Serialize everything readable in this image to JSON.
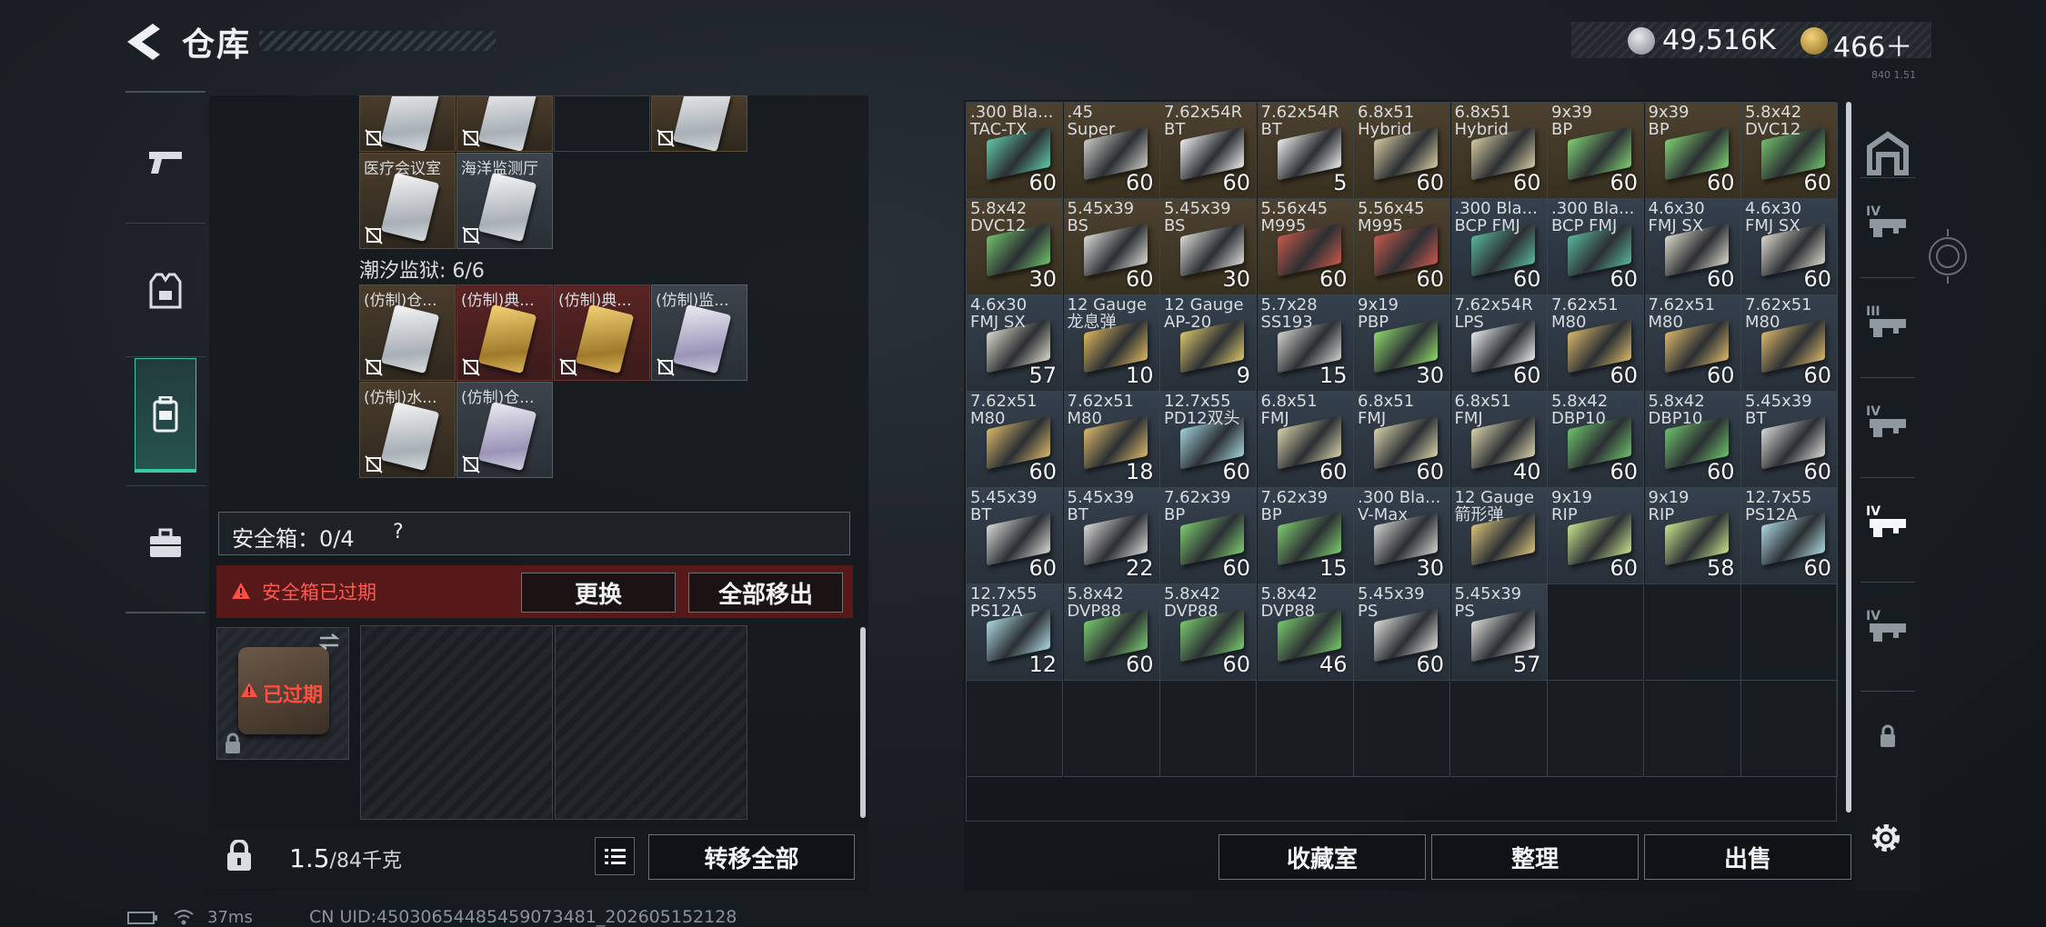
{
  "header": {
    "title": "仓库",
    "currency": [
      {
        "icon": "silver-coin-icon",
        "value": "49,516K"
      },
      {
        "icon": "gold-coin-icon",
        "value": "466＋"
      }
    ],
    "version_tiny": "840 1.51"
  },
  "left_nav": {
    "items": [
      {
        "name": "weapons",
        "icon": "pistol-icon",
        "active": false
      },
      {
        "name": "equipment",
        "icon": "vest-icon",
        "active": false
      },
      {
        "name": "storage",
        "icon": "backpack-icon",
        "active": true
      },
      {
        "name": "cases",
        "icon": "briefcase-icon",
        "active": false
      }
    ]
  },
  "keycards": {
    "top_row": [
      {
        "label": "",
        "style": "brown",
        "card": "white"
      },
      {
        "label": "",
        "style": "brown",
        "card": "white"
      },
      {
        "label": "",
        "style": "empty",
        "card": ""
      },
      {
        "label": "",
        "style": "brown",
        "card": "white"
      }
    ],
    "row2": [
      {
        "label": "医疗会议室",
        "style": "brown",
        "card": "white"
      },
      {
        "label": "海洋监测厅",
        "style": "gray",
        "card": "white"
      }
    ],
    "prison_label": "潮汐监狱: 6/6",
    "prison_row1": [
      {
        "label": "(仿制)仓...",
        "style": "brown",
        "card": "white"
      },
      {
        "label": "(仿制)典...",
        "style": "red",
        "card": "gold"
      },
      {
        "label": "(仿制)典...",
        "style": "red",
        "card": "gold"
      },
      {
        "label": "(仿制)监...",
        "style": "gray",
        "card": "purple"
      }
    ],
    "prison_row2": [
      {
        "label": "(仿制)水...",
        "style": "brown",
        "card": "white"
      },
      {
        "label": "(仿制)仓...",
        "style": "gray",
        "card": "purple"
      }
    ]
  },
  "safe_box": {
    "label": "安全箱：0/4",
    "help": "?",
    "expired_text": "安全箱已过期",
    "replace_label": "更换",
    "move_all_label": "全部移出",
    "case_expired_label": "已过期"
  },
  "weight": {
    "current": "1.5",
    "max": "/84千克",
    "transfer_label": "转移全部"
  },
  "ammo_grid": [
    {
      "name": ".300 Bla...\nTAC-TX",
      "count": "60",
      "color": "#5fc6a8",
      "tone": "b"
    },
    {
      "name": ".45\nSuper",
      "count": "60",
      "color": "#c9c9c4",
      "tone": "b"
    },
    {
      "name": "7.62x54R\nBT",
      "count": "60",
      "color": "#e9eaeb",
      "tone": "b"
    },
    {
      "name": "7.62x54R\nBT",
      "count": "5",
      "color": "#e9eaeb",
      "tone": "b"
    },
    {
      "name": "6.8x51\nHybrid",
      "count": "60",
      "color": "#d2c8a0",
      "tone": "b"
    },
    {
      "name": "6.8x51\nHybrid",
      "count": "60",
      "color": "#d2c8a0",
      "tone": "b"
    },
    {
      "name": "9x39\nBP",
      "count": "60",
      "color": "#7fcf72",
      "tone": "b"
    },
    {
      "name": "9x39\nBP",
      "count": "60",
      "color": "#7fcf72",
      "tone": "b"
    },
    {
      "name": "5.8x42\nDVC12",
      "count": "60",
      "color": "#6fbf6a",
      "tone": "b"
    },
    {
      "name": "5.8x42\nDVC12",
      "count": "30",
      "color": "#6fbf6a",
      "tone": "b"
    },
    {
      "name": "5.45x39\nBS",
      "count": "60",
      "color": "#d8d8d4",
      "tone": "b"
    },
    {
      "name": "5.45x39\nBS",
      "count": "30",
      "color": "#d8d8d4",
      "tone": "b"
    },
    {
      "name": "5.56x45\nM995",
      "count": "60",
      "color": "#c4584a",
      "tone": "b"
    },
    {
      "name": "5.56x45\nM995",
      "count": "60",
      "color": "#c4584a",
      "tone": "b"
    },
    {
      "name": ".300 Bla...\nBCP FMJ",
      "count": "60",
      "color": "#58b59a",
      "tone": "g"
    },
    {
      "name": ".300 Bla...\nBCP FMJ",
      "count": "60",
      "color": "#58b59a",
      "tone": "g"
    },
    {
      "name": "4.6x30\nFMJ SX",
      "count": "60",
      "color": "#d9d5c8",
      "tone": "g"
    },
    {
      "name": "4.6x30\nFMJ SX",
      "count": "60",
      "color": "#d9d5c8",
      "tone": "g"
    },
    {
      "name": "4.6x30\nFMJ SX",
      "count": "57",
      "color": "#d9d5c8",
      "tone": "g"
    },
    {
      "name": "12 Gauge\n龙息弹",
      "count": "10",
      "color": "#d9b55c",
      "tone": "g"
    },
    {
      "name": "12 Gauge\nAP-20",
      "count": "9",
      "color": "#d9c36a",
      "tone": "g"
    },
    {
      "name": "5.7x28\nSS193",
      "count": "15",
      "color": "#cfcfca",
      "tone": "g"
    },
    {
      "name": "9x19\nPBP",
      "count": "30",
      "color": "#8fd86a",
      "tone": "g"
    },
    {
      "name": "7.62x54R\nLPS",
      "count": "60",
      "color": "#e6e7e8",
      "tone": "g"
    },
    {
      "name": "7.62x51\nM80",
      "count": "60",
      "color": "#d8b66a",
      "tone": "g"
    },
    {
      "name": "7.62x51\nM80",
      "count": "60",
      "color": "#d8b66a",
      "tone": "g"
    },
    {
      "name": "7.62x51\nM80",
      "count": "60",
      "color": "#d8b66a",
      "tone": "g"
    },
    {
      "name": "7.62x51\nM80",
      "count": "60",
      "color": "#d8b66a",
      "tone": "g"
    },
    {
      "name": "7.62x51\nM80",
      "count": "18",
      "color": "#d8b66a",
      "tone": "g"
    },
    {
      "name": "12.7x55\nPD12双头",
      "count": "60",
      "color": "#9fd0d8",
      "tone": "g"
    },
    {
      "name": "6.8x51\nFMJ",
      "count": "60",
      "color": "#d6cfa9",
      "tone": "g"
    },
    {
      "name": "6.8x51\nFMJ",
      "count": "60",
      "color": "#d6cfa9",
      "tone": "g"
    },
    {
      "name": "6.8x51\nFMJ",
      "count": "40",
      "color": "#d6cfa9",
      "tone": "g"
    },
    {
      "name": "5.8x42\nDBP10",
      "count": "60",
      "color": "#6cc06a",
      "tone": "g"
    },
    {
      "name": "5.8x42\nDBP10",
      "count": "60",
      "color": "#6cc06a",
      "tone": "g"
    },
    {
      "name": "5.45x39\nBT",
      "count": "60",
      "color": "#d6d6d2",
      "tone": "g"
    },
    {
      "name": "5.45x39\nBT",
      "count": "60",
      "color": "#d6d6d2",
      "tone": "g"
    },
    {
      "name": "5.45x39\nBT",
      "count": "22",
      "color": "#d6d6d2",
      "tone": "g"
    },
    {
      "name": "7.62x39\nBP",
      "count": "60",
      "color": "#7dca6f",
      "tone": "g"
    },
    {
      "name": "7.62x39\nBP",
      "count": "15",
      "color": "#7dca6f",
      "tone": "g"
    },
    {
      "name": ".300 Bla...\nV-Max",
      "count": "30",
      "color": "#cfcfca",
      "tone": "g"
    },
    {
      "name": "12 Gauge\n箭形弹",
      "count": "",
      "color": "#d6c07a",
      "tone": "g"
    },
    {
      "name": "9x19\nRIP",
      "count": "60",
      "color": "#c6e08a",
      "tone": "g"
    },
    {
      "name": "9x19\nRIP",
      "count": "58",
      "color": "#c6e08a",
      "tone": "g"
    },
    {
      "name": "12.7x55\nPS12A",
      "count": "60",
      "color": "#aad6de",
      "tone": "g"
    },
    {
      "name": "12.7x55\nPS12A",
      "count": "12",
      "color": "#aad6de",
      "tone": "g"
    },
    {
      "name": "5.8x42\nDVP88",
      "count": "60",
      "color": "#78c86c",
      "tone": "g"
    },
    {
      "name": "5.8x42\nDVP88",
      "count": "60",
      "color": "#78c86c",
      "tone": "g"
    },
    {
      "name": "5.8x42\nDVP88",
      "count": "46",
      "color": "#78c86c",
      "tone": "g"
    },
    {
      "name": "5.45x39\nPS",
      "count": "60",
      "color": "#dadad6",
      "tone": "g"
    },
    {
      "name": "5.45x39\nPS",
      "count": "57",
      "color": "#dadad6",
      "tone": "g"
    }
  ],
  "grid_total_rows": 7,
  "bottom_buttons": {
    "collection": "收藏室",
    "tidy": "整理",
    "sell": "出售"
  },
  "right_nav": [
    {
      "icon": "safehouse-icon",
      "tier": ""
    },
    {
      "icon": "rifle-tier4-icon",
      "tier": "IV"
    },
    {
      "icon": "rifle-tier3-icon",
      "tier": "III"
    },
    {
      "icon": "rifle-tier4b-icon",
      "tier": "IV"
    },
    {
      "icon": "ammo-box-tier4-icon",
      "tier": "IV"
    },
    {
      "icon": "rifle-tier4c-icon",
      "tier": "IV"
    },
    {
      "icon": "lock-icon",
      "tier": ""
    }
  ],
  "status": {
    "ping": "37ms",
    "uid": "CN UID:45030654485459073481_202605152128"
  }
}
